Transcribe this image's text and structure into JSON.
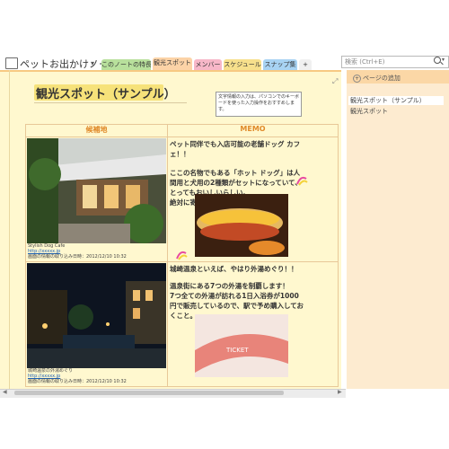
{
  "notebook": {
    "title": "ペットお出かけノート",
    "caret": "▾"
  },
  "tabs": [
    {
      "label": "このノートの特長",
      "color": "#b8e09c"
    },
    {
      "label": "観光スポット",
      "color": "#fcd3a7"
    },
    {
      "label": "メンバー",
      "color": "#f7b7c8"
    },
    {
      "label": "スケジュール",
      "color": "#f7e08c"
    },
    {
      "label": "スナップ集",
      "color": "#a8d3f3"
    },
    {
      "label": "+",
      "color": "#f0f0f0"
    }
  ],
  "search": {
    "placeholder": "検索 (Ctrl+E)"
  },
  "page": {
    "title": "観光スポット（サンプル）",
    "note": "文字情報の入力は、パソコンでのキーボードを使った入力操作をおすすめします。",
    "headers": {
      "candidate": "候補地",
      "memo": "MEMO"
    },
    "rows": [
      {
        "caption": "Stylish Dog Cafe",
        "link": "http://xxxxx.jp",
        "date": "画面の情報の取り込み日時：2012/12/10 10:32",
        "memo_lines": [
          "ペット同伴でも入店可能の老舗ドッグ カフェ！！",
          "ここの名物でもある「ホット ドッグ」は人間用と犬用の2種類がセットになっていて、とってもおいしいらしい。",
          "絶対に寄りたいカフェ！！"
        ]
      },
      {
        "caption": "城崎温泉の外湯めぐり",
        "link": "http://xxxxx.jp",
        "date": "画面の情報の取り込み日時：2012/12/10 10:32",
        "memo_lines": [
          "城崎温泉といえば、やはり外湯めぐり！！",
          "温泉街にある7つの外湯を制覇します！",
          "7つ全ての外湯が訪れる1日入浴券が1000円で販売しているので、駅で予め購入しておくこと。"
        ]
      }
    ]
  },
  "sidebar": {
    "add_label": "ページの追加",
    "pages": [
      "観光スポット（サンプル）",
      "観光スポット"
    ]
  },
  "colors": {
    "page_bg": "#fff8cf",
    "header_text": "#e08a2a",
    "sidebar_bg": "#fdebd0"
  }
}
